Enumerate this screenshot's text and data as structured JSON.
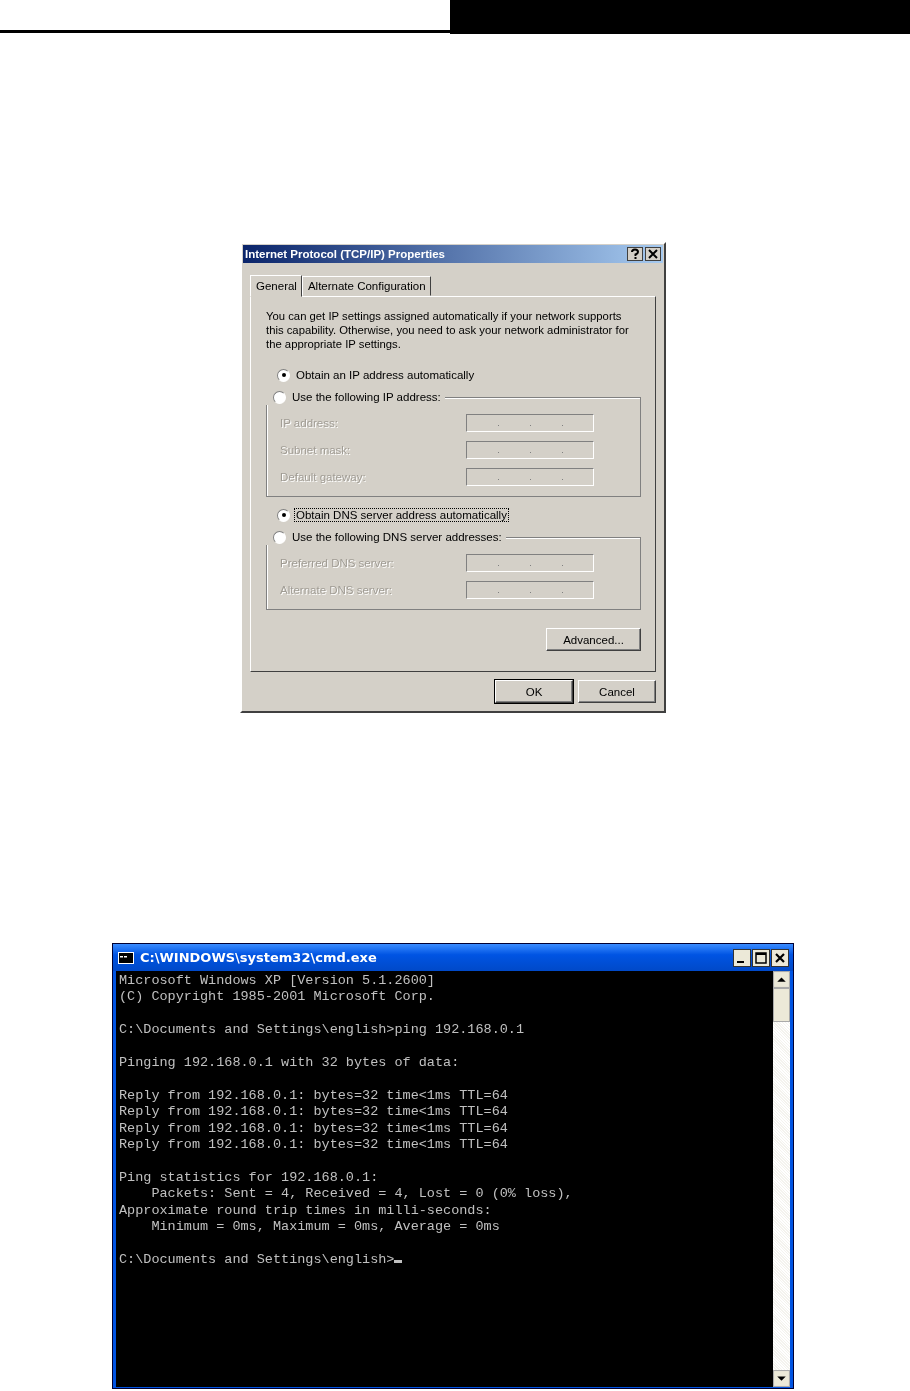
{
  "dialog": {
    "title": "Internet Protocol (TCP/IP) Properties",
    "tabs": [
      {
        "label": "General",
        "selected": true
      },
      {
        "label": "Alternate Configuration",
        "selected": false
      }
    ],
    "intro": "You can get IP settings assigned automatically if your network supports this capability. Otherwise, you need to ask your network administrator for the appropriate IP settings.",
    "groups": [
      {
        "auto": {
          "label": "Obtain an IP address automatically",
          "selected": true,
          "focused": false
        },
        "manual": {
          "label": "Use the following IP address:",
          "selected": false
        },
        "fields": [
          {
            "label": "IP address:",
            "disabled": true
          },
          {
            "label": "Subnet mask:",
            "disabled": true
          },
          {
            "label": "Default gateway:",
            "disabled": true
          }
        ]
      },
      {
        "auto": {
          "label": "Obtain DNS server address automatically",
          "selected": true,
          "focused": true
        },
        "manual": {
          "label": "Use the following DNS server addresses:",
          "selected": false
        },
        "fields": [
          {
            "label": "Preferred DNS server:",
            "disabled": true
          },
          {
            "label": "Alternate DNS server:",
            "disabled": true
          }
        ]
      }
    ],
    "advanced_button": "Advanced...",
    "buttons": [
      {
        "label": "OK",
        "default": true
      },
      {
        "label": "Cancel",
        "default": false
      }
    ]
  },
  "console": {
    "title": "C:\\WINDOWS\\system32\\cmd.exe",
    "blocks": [
      [
        "Microsoft Windows XP [Version 5.1.2600]",
        "(C) Copyright 1985-2001 Microsoft Corp."
      ],
      [
        "C:\\Documents and Settings\\english>ping 192.168.0.1"
      ],
      [
        "Pinging 192.168.0.1 with 32 bytes of data:"
      ],
      [
        "Reply from 192.168.0.1: bytes=32 time<1ms TTL=64",
        "Reply from 192.168.0.1: bytes=32 time<1ms TTL=64",
        "Reply from 192.168.0.1: bytes=32 time<1ms TTL=64",
        "Reply from 192.168.0.1: bytes=32 time<1ms TTL=64"
      ],
      [
        "Ping statistics for 192.168.0.1:",
        "    Packets: Sent = 4, Received = 4, Lost = 0 (0% loss),",
        "Approximate round trip times in milli-seconds:",
        "    Minimum = 0ms, Maximum = 0ms, Average = 0ms"
      ],
      [
        "C:\\Documents and Settings\\english>"
      ]
    ],
    "cursor": true
  }
}
